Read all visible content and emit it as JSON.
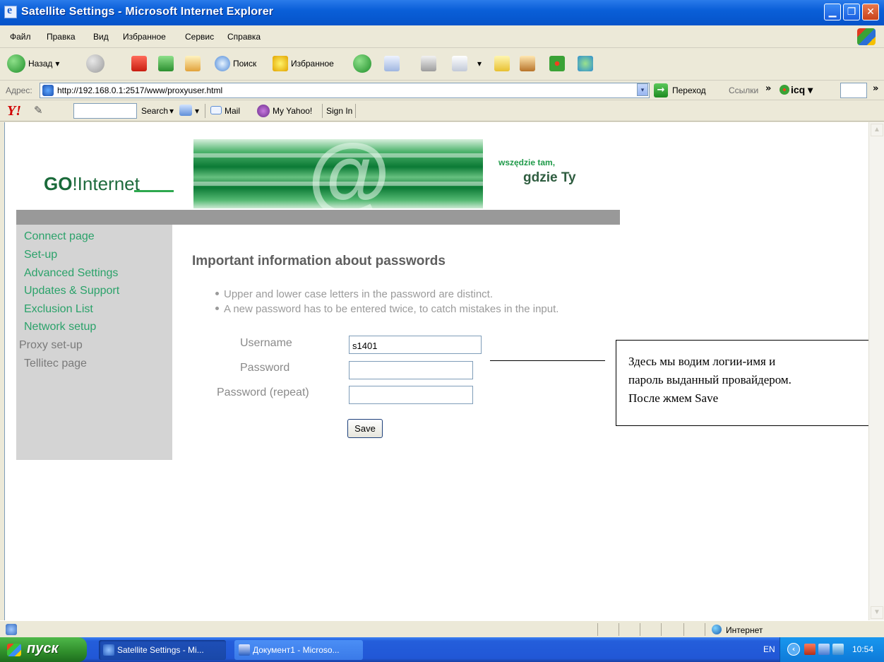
{
  "window": {
    "title": "Satellite Settings - Microsoft Internet Explorer",
    "minimize_glyph": "▁",
    "maximize_glyph": "❐",
    "close_glyph": "✕"
  },
  "menu": [
    "Файл",
    "Правка",
    "Вид",
    "Избранное",
    "Сервис",
    "Справка"
  ],
  "toolbar": {
    "back_label": "Назад",
    "search_label": "Поиск",
    "favorites_label": "Избранное",
    "dropdown_glyph": "▾"
  },
  "address_bar": {
    "label": "Адрес:",
    "url": "http://192.168.0.1:2517/www/proxyuser.html",
    "go_label": "Переход",
    "links_label": "Ссылки",
    "chevron": "»",
    "icq_label": "icq",
    "go_glyph": "→",
    "dropdown_glyph": "▾"
  },
  "yahoo_bar": {
    "logo": "Y!",
    "search_label": "Search",
    "mail_label": "Mail",
    "my_yahoo_label": "My Yahoo!",
    "sign_in_label": "Sign In",
    "pen_glyph": "✎"
  },
  "page": {
    "logo_go": "GO",
    "logo_bang": "!Inter",
    "logo_net": "net",
    "banner_symbol": "@",
    "tagline_1": "wszędzie tam,",
    "tagline_2": "gdzie Ty",
    "nav": [
      {
        "label": "Connect page",
        "active": true
      },
      {
        "label": "Set-up",
        "active": true
      },
      {
        "label": "Advanced Settings",
        "active": true
      },
      {
        "label": "Updates & Support",
        "active": true
      },
      {
        "label": "Exclusion List",
        "active": true
      },
      {
        "label": "Network setup",
        "active": true
      },
      {
        "label": "Proxy set-up",
        "active": false
      },
      {
        "label": "Tellitec page",
        "active": false
      }
    ],
    "heading": "Important information about passwords",
    "bullets": [
      "Upper and lower case letters in the password are distinct.",
      "A new password has to be entered twice, to catch mistakes in the input."
    ],
    "form": {
      "username_label": "Username",
      "username_value": "s1401",
      "password_label": "Password",
      "password_value": "",
      "password_repeat_label": "Password (repeat)",
      "password_repeat_value": "",
      "save_label": "Save"
    }
  },
  "annotation": {
    "lines": [
      "Здесь мы водим логии-имя и",
      "пароль выданный провайдером.",
      "После жмем Save"
    ]
  },
  "status_bar": {
    "zone": "Интернет"
  },
  "taskbar": {
    "start_label": "пуск",
    "tasks": [
      "Satellite Settings - Mi...",
      "Документ1 - Microso..."
    ],
    "language": "EN",
    "clock": "10:54",
    "tray_chevron": "‹"
  },
  "colors": {
    "nav_link": "#2ba26a",
    "nav_inactive": "#7a7a7a",
    "brand_green": "#1e6b3d",
    "sidebar_bg": "#d4d4d4",
    "header_bar": "#999999"
  }
}
